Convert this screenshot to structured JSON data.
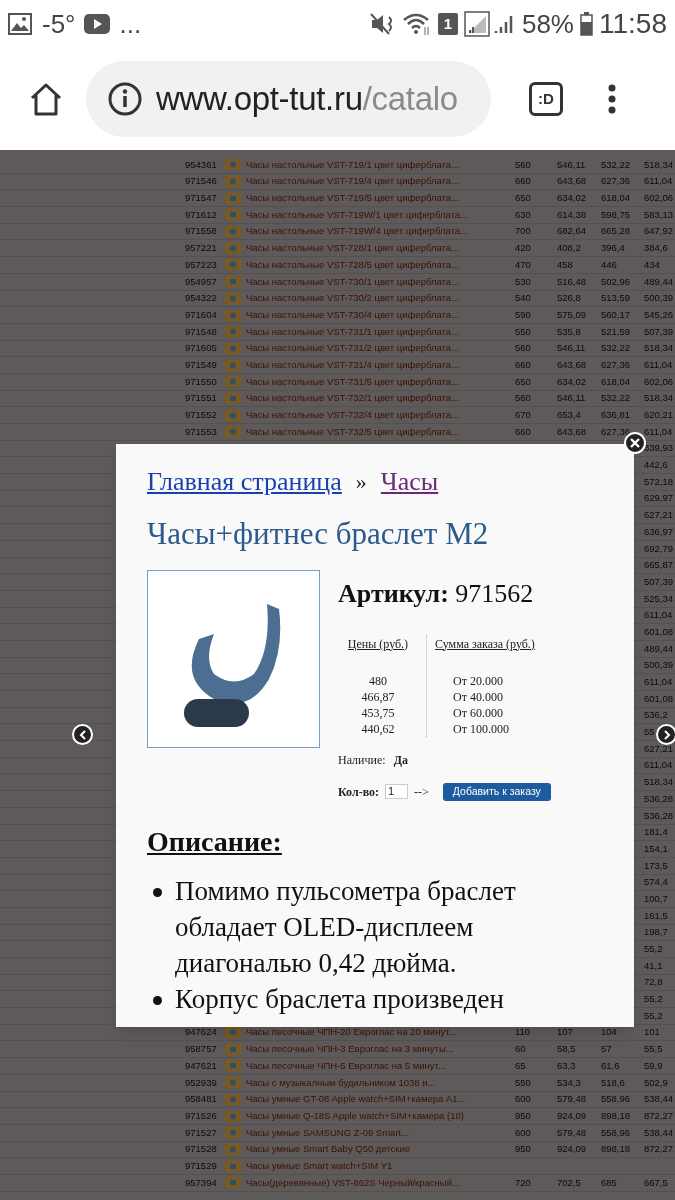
{
  "status_bar": {
    "temperature": "-5°",
    "more": "...",
    "sim": "1",
    "battery": "58%",
    "time": "11:58"
  },
  "browser": {
    "url_host": "www.opt-tut.ru",
    "url_path": "/catalo",
    "tab_button": ":D"
  },
  "background_table": {
    "rows": [
      {
        "column_1": "954361",
        "column_3": "Часы настольные VST-719/1 цвет циферблата...",
        "column_4": "560",
        "column_5": "546,11",
        "column_6": "532,22",
        "column_7": "518,34"
      },
      {
        "column_1": "971546",
        "column_3": "Часы настольные VST-719/4 цвет циферблата...",
        "column_4": "660",
        "column_5": "643,68",
        "column_6": "627,36",
        "column_7": "611,04"
      },
      {
        "column_1": "971547",
        "column_3": "Часы настольные VST-719/5 цвет циферблата...",
        "column_4": "650",
        "column_5": "634,02",
        "column_6": "618,04",
        "column_7": "602,06"
      },
      {
        "column_1": "971612",
        "column_3": "Часы настольные VST-719W/1 цвет циферблата...",
        "column_4": "630",
        "column_5": "614,38",
        "column_6": "598,75",
        "column_7": "583,13"
      },
      {
        "column_1": "971558",
        "column_3": "Часы настольные VST-719W/4 цвет циферблата...",
        "column_4": "700",
        "column_5": "682,64",
        "column_6": "665,28",
        "column_7": "647,92"
      },
      {
        "column_1": "957221",
        "column_3": "Часы настольные VST-728/1 цвет циферблата...",
        "column_4": "420",
        "column_5": "408,2",
        "column_6": "396,4",
        "column_7": "384,6"
      },
      {
        "column_1": "957223",
        "column_3": "Часы настольные VST-728/5 цвет циферблата...",
        "column_4": "470",
        "column_5": "458",
        "column_6": "446",
        "column_7": "434"
      },
      {
        "column_1": "954957",
        "column_3": "Часы настольные VST-730/1 цвет циферблата...",
        "column_4": "530",
        "column_5": "516,48",
        "column_6": "502,96",
        "column_7": "489,44"
      },
      {
        "column_1": "954322",
        "column_3": "Часы настольные VST-730/2 цвет циферблата...",
        "column_4": "540",
        "column_5": "526,8",
        "column_6": "513,59",
        "column_7": "500,39"
      },
      {
        "column_1": "971604",
        "column_3": "Часы настольные VST-730/4 цвет циферблата...",
        "column_4": "590",
        "column_5": "575,09",
        "column_6": "560,17",
        "column_7": "545,26"
      },
      {
        "column_1": "971548",
        "column_3": "Часы настольные VST-731/1 цвет циферблата...",
        "column_4": "550",
        "column_5": "535,8",
        "column_6": "521,59",
        "column_7": "507,39"
      },
      {
        "column_1": "971605",
        "column_3": "Часы настольные VST-731/2 цвет циферблата...",
        "column_4": "560",
        "column_5": "546,11",
        "column_6": "532,22",
        "column_7": "518,34"
      },
      {
        "column_1": "971549",
        "column_3": "Часы настольные VST-731/4 цвет циферблата...",
        "column_4": "660",
        "column_5": "643,68",
        "column_6": "627,36",
        "column_7": "611,04"
      },
      {
        "column_1": "971550",
        "column_3": "Часы настольные VST-731/5 цвет циферблата...",
        "column_4": "650",
        "column_5": "634,02",
        "column_6": "618,04",
        "column_7": "602,06"
      },
      {
        "column_1": "971551",
        "column_3": "Часы настольные VST-732/1 цвет циферблата...",
        "column_4": "560",
        "column_5": "546,11",
        "column_6": "532,22",
        "column_7": "518,34"
      },
      {
        "column_1": "971552",
        "column_3": "Часы настольные VST-732/4 цвет циферблата...",
        "column_4": "670",
        "column_5": "653,4",
        "column_6": "636,81",
        "column_7": "620,21"
      },
      {
        "column_1": "971553",
        "column_3": "Часы настольные VST-732/5 цвет циферблата...",
        "column_4": "660",
        "column_5": "643,68",
        "column_6": "627,36",
        "column_7": "611,04"
      },
      {
        "column_7": "339,93"
      },
      {
        "column_7": "442,6"
      },
      {
        "column_7": "572,18"
      },
      {
        "column_7": "629,97"
      },
      {
        "column_7": "627,21"
      },
      {
        "column_7": "636,97"
      },
      {
        "column_7": "692,79"
      },
      {
        "column_7": "665,87"
      },
      {
        "column_7": "507,39"
      },
      {
        "column_7": "525,34"
      },
      {
        "column_7": "611,04"
      },
      {
        "column_7": "601,08"
      },
      {
        "column_7": "489,44"
      },
      {
        "column_7": "500,39"
      },
      {
        "column_7": "611,04"
      },
      {
        "column_7": "601,08"
      },
      {
        "column_7": "536,2"
      },
      {
        "column_7": "55"
      },
      {
        "column_7": "627,21"
      },
      {
        "column_7": "611,04"
      },
      {
        "column_7": "518,34"
      },
      {
        "column_7": "536,28"
      },
      {
        "column_7": "536,28"
      },
      {
        "column_7": "181,4"
      },
      {
        "column_7": "154,1"
      },
      {
        "column_7": "173,5"
      },
      {
        "column_7": "574,4"
      },
      {
        "column_7": "100,7"
      },
      {
        "column_7": "161,5"
      },
      {
        "column_7": "198,7"
      },
      {
        "column_7": "55,2"
      },
      {
        "column_7": "41,1"
      },
      {
        "column_7": "72,8"
      },
      {
        "column_7": "55,2"
      },
      {
        "column_7": "55,2"
      },
      {
        "column_1": "947624",
        "column_3": "Часы песочные ЧПН-20 Евроглас на 20 минут...",
        "column_4": "110",
        "column_5": "107",
        "column_6": "104",
        "column_7": "101"
      },
      {
        "column_1": "958757",
        "column_3": "Часы песочные ЧПН-3 Евроглас на 3 минуты...",
        "column_4": "60",
        "column_5": "58,5",
        "column_6": "57",
        "column_7": "55,5"
      },
      {
        "column_1": "947621",
        "column_3": "Часы песочные ЧПН-5 Евроглас на 5 минут...",
        "column_4": "65",
        "column_5": "63,3",
        "column_6": "61,6",
        "column_7": "59,9"
      },
      {
        "column_1": "952939",
        "column_3": "Часы с музыкалным будильником 1038 и...",
        "column_4": "550",
        "column_5": "534,3",
        "column_6": "518,6",
        "column_7": "502,9"
      },
      {
        "column_1": "958481",
        "column_3": "Часы умные GT-08 Apple watch+SIM+камера A1...",
        "column_4": "600",
        "column_5": "579,48",
        "column_6": "558,96",
        "column_7": "538,44"
      },
      {
        "column_1": "971526",
        "column_3": "Часы умные Q-18S Apple watch+SIM+камера (10)",
        "column_4": "950",
        "column_5": "924,09",
        "column_6": "898,18",
        "column_7": "872,27"
      },
      {
        "column_1": "971527",
        "column_3": "Часы умные SAMSUNG Z-09 Smart...",
        "column_4": "600",
        "column_5": "579,48",
        "column_6": "558,96",
        "column_7": "538,44"
      },
      {
        "column_1": "971528",
        "column_3": "Часы умные Smart Baby Q50 детские",
        "column_4": "950",
        "column_5": "924,09",
        "column_6": "898,18",
        "column_7": "872,27"
      },
      {
        "column_1": "971529",
        "column_3": "Часы умные Smart watch+SIM Y1"
      },
      {
        "column_1": "957394",
        "column_3": "Часы(деревянные) VST-862S Черный/красный...",
        "column_4": "720",
        "column_5": "702,5",
        "column_6": "685",
        "column_7": "667,5"
      }
    ]
  },
  "modal": {
    "breadcrumb": [
      {
        "label": "Главная страница",
        "visited": false
      },
      {
        "label": "Часы",
        "visited": true
      }
    ],
    "separator": "»",
    "title": "Часы+фитнес браслет M2",
    "article_label": "Артикул:",
    "article": "971562",
    "price_headers": [
      "Цены (руб.)",
      "Сумма заказа (руб.)"
    ],
    "prices": [
      {
        "price": "480",
        "order_sum": "От 20.000"
      },
      {
        "price": "466,87",
        "order_sum": "От 40.000"
      },
      {
        "price": "453,75",
        "order_sum": "От 60.000"
      },
      {
        "price": "440,62",
        "order_sum": "От 100.000"
      }
    ],
    "availability_label": "Наличие:",
    "availability": "Да",
    "quantity_label": "Кол-во:",
    "quantity": "1",
    "arrow": "-->",
    "add_button": "Добавить к заказу",
    "description_heading": "Описание:",
    "description_items": [
      "Помимо пульсометра браслет обладает OLED-дисплеем диагональю 0,42 дюйма.",
      "Корпус браслета произведен"
    ]
  }
}
